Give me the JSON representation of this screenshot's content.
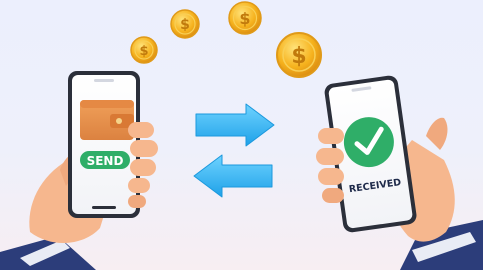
{
  "left_phone": {
    "send_label": "SEND"
  },
  "right_phone": {
    "status_label": "RECEIVED"
  },
  "coins": {
    "symbol": "$",
    "count": 5
  },
  "colors": {
    "background": "#eceffd",
    "wallet": "#e8904a",
    "send_badge": "#2fae68",
    "received_check": "#2fae68",
    "arrows": "#38b8f2",
    "coin_gold": "#f6b21d",
    "skin": "#f6b78e",
    "sleeve": "#2c3d7a"
  },
  "icons": [
    "wallet-icon",
    "check-icon",
    "arrow-right-icon",
    "arrow-left-icon",
    "dollar-coin-icon"
  ]
}
